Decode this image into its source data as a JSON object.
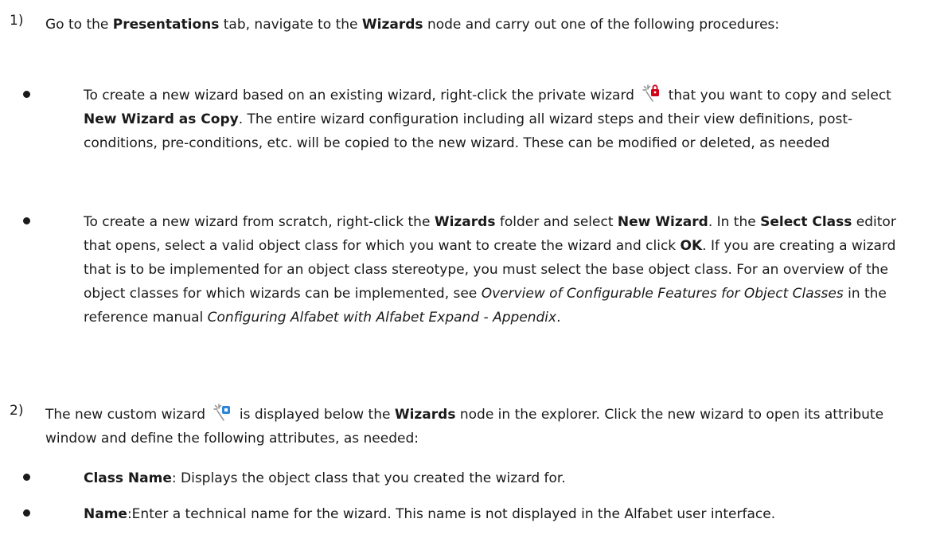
{
  "steps": [
    {
      "number": "1)",
      "t1": "Go to the ",
      "b1": "Presentations",
      "t2": " tab, navigate to the ",
      "b2": "Wizards",
      "t3": " node and carry out one of the following procedures:"
    },
    {
      "number": "2)",
      "t1": "The new custom wizard ",
      "t2": " is displayed below the ",
      "b1": "Wizards",
      "t3": " node in the explorer. Click the new wizard to open its attribute window and define the following attributes, as needed:"
    }
  ],
  "bullets": [
    {
      "t1": "To create a new wizard based on an existing wizard, right-click the private wizard ",
      "t2": " that you want to copy and select ",
      "b1": "New Wizard as Copy",
      "t3": ". The entire wizard configuration including all wizard steps and their view definitions, post-conditions, pre-conditions, etc. will be copied to the new wizard. These can be modified or deleted, as needed"
    },
    {
      "t1": "To create a new wizard from scratch, right-click the ",
      "b1": "Wizards",
      "t2": " folder and select ",
      "b2": "New Wizard",
      "t3": ". In the ",
      "b3": "Select Class",
      "t4": " editor that opens, select a valid object class for which you want to create the wizard and click ",
      "b4": "OK",
      "t5": ". If you are creating a wizard that is to be implemented for an object class stereotype, you must select the base object class. For an overview of the object classes for which wizards can be implemented, see ",
      "i1": "Overview of Configurable Features for Object Classes",
      "t6": " in the reference manual ",
      "i2": "Configuring Alfabet with Alfabet Expand - Appendix",
      "t7": "."
    },
    {
      "b1": "Class Name",
      "t1": ": Displays the object class that you created the wizard for."
    },
    {
      "b1": "Name",
      "t1": ":Enter a technical name for the wizard. This name is not displayed in the Alfabet user interface."
    }
  ],
  "icons": {
    "private_wizard": "wizard-lock-icon",
    "custom_wizard": "wizard-custom-icon"
  },
  "colors": {
    "text": "#1a1a1a",
    "lock_red": "#d0021b",
    "custom_blue": "#2e86d6"
  }
}
